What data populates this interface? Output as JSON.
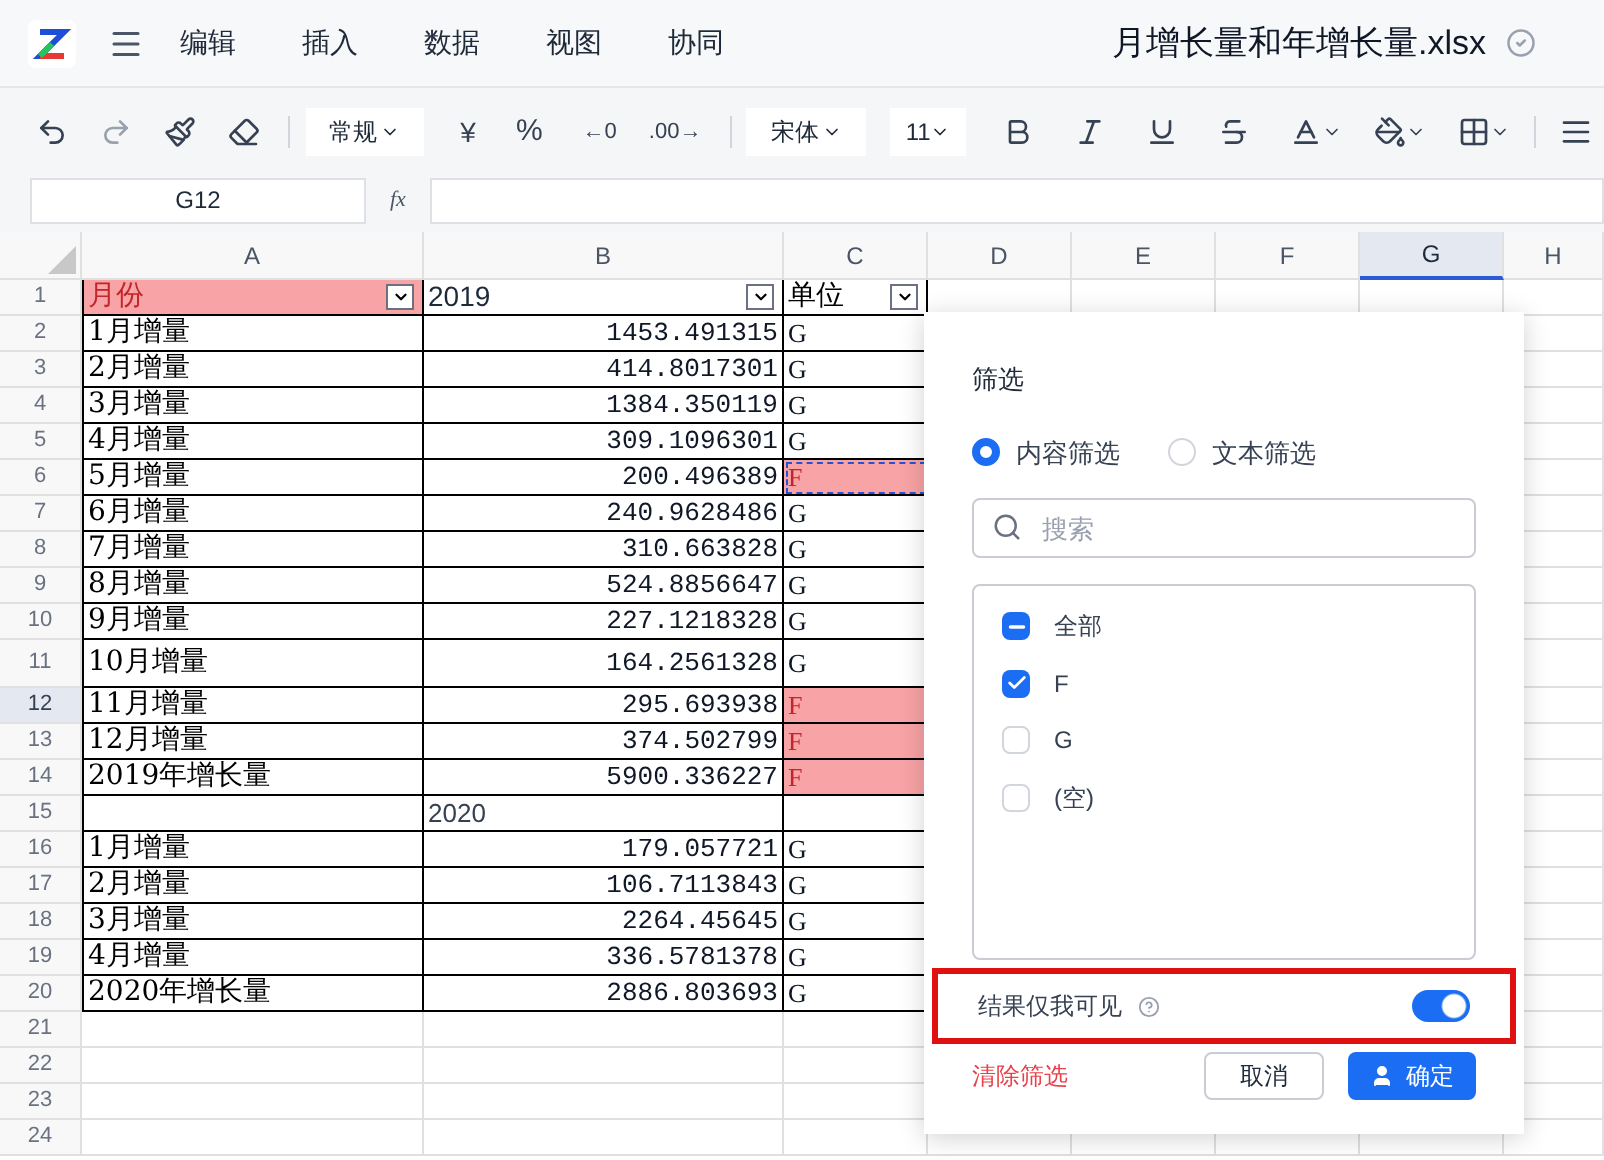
{
  "app": {
    "menu": [
      "编辑",
      "插入",
      "数据",
      "视图",
      "协同"
    ],
    "file_name": "月增长量和年增长量.xlsx"
  },
  "toolbar": {
    "number_format": "常规",
    "currency": "¥",
    "percent": "%",
    "decrease_decimal": "←0",
    "increase_decimal": ".00→",
    "font": "宋体",
    "font_size": "11"
  },
  "formula_bar": {
    "name_box": "G12",
    "fx": "fx"
  },
  "columns": [
    {
      "label": "A",
      "selected": false
    },
    {
      "label": "B",
      "selected": false
    },
    {
      "label": "C",
      "selected": false
    },
    {
      "label": "D",
      "selected": false
    },
    {
      "label": "E",
      "selected": false
    },
    {
      "label": "F",
      "selected": false
    },
    {
      "label": "G",
      "selected": true
    },
    {
      "label": "H",
      "selected": false
    }
  ],
  "rows": [
    {
      "n": "1",
      "kind": "header",
      "a": "月份",
      "b": "2019",
      "c": "单位",
      "selected": false
    },
    {
      "n": "2",
      "kind": "data",
      "a": "1月增量",
      "b": "1453.491315",
      "c": "G",
      "highlighted": false,
      "marquee": false,
      "selected": false
    },
    {
      "n": "3",
      "kind": "data",
      "a": "2月增量",
      "b": "414.8017301",
      "c": "G",
      "highlighted": false,
      "marquee": false,
      "selected": false
    },
    {
      "n": "4",
      "kind": "data",
      "a": "3月增量",
      "b": "1384.350119",
      "c": "G",
      "highlighted": false,
      "marquee": false,
      "selected": false
    },
    {
      "n": "5",
      "kind": "data",
      "a": "4月增量",
      "b": "309.1096301",
      "c": "G",
      "highlighted": false,
      "marquee": false,
      "selected": false
    },
    {
      "n": "6",
      "kind": "data",
      "a": "5月增量",
      "b": "200.496389",
      "c": "F",
      "highlighted": true,
      "marquee": true,
      "selected": false
    },
    {
      "n": "7",
      "kind": "data",
      "a": "6月增量",
      "b": "240.9628486",
      "c": "G",
      "highlighted": false,
      "marquee": false,
      "selected": false
    },
    {
      "n": "8",
      "kind": "data",
      "a": "7月增量",
      "b": "310.663828",
      "c": "G",
      "highlighted": false,
      "marquee": false,
      "selected": false
    },
    {
      "n": "9",
      "kind": "data",
      "a": "8月增量",
      "b": "524.8856647",
      "c": "G",
      "highlighted": false,
      "marquee": false,
      "selected": false
    },
    {
      "n": "10",
      "kind": "data",
      "a": "9月增量",
      "b": "227.1218328",
      "c": "G",
      "highlighted": false,
      "marquee": false,
      "selected": false
    },
    {
      "n": "11",
      "kind": "data",
      "tall": true,
      "a": "10月增量",
      "b": "164.2561328",
      "c": "G",
      "highlighted": false,
      "marquee": false,
      "selected": false
    },
    {
      "n": "12",
      "kind": "data",
      "a": "11月增量",
      "b": "295.693938",
      "c": "F",
      "highlighted": true,
      "marquee": false,
      "selected": true
    },
    {
      "n": "13",
      "kind": "data",
      "a": "12月增量",
      "b": "374.502799",
      "c": "F",
      "highlighted": true,
      "marquee": false,
      "selected": false
    },
    {
      "n": "14",
      "kind": "data",
      "a": "2019年增长量",
      "b": "5900.336227",
      "c": "F",
      "highlighted": true,
      "marquee": false,
      "selected": false
    },
    {
      "n": "15",
      "kind": "year",
      "b": "2020",
      "selected": false
    },
    {
      "n": "16",
      "kind": "data",
      "a": "1月增量",
      "b": "179.057721",
      "c": "G",
      "highlighted": false,
      "marquee": false,
      "selected": false
    },
    {
      "n": "17",
      "kind": "data",
      "a": "2月增量",
      "b": "106.7113843",
      "c": "G",
      "highlighted": false,
      "marquee": false,
      "selected": false
    },
    {
      "n": "18",
      "kind": "data",
      "a": "3月增量",
      "b": "2264.45645",
      "c": "G",
      "highlighted": false,
      "marquee": false,
      "selected": false
    },
    {
      "n": "19",
      "kind": "data",
      "a": "4月增量",
      "b": "336.5781378",
      "c": "G",
      "highlighted": false,
      "marquee": false,
      "selected": false
    },
    {
      "n": "20",
      "kind": "data",
      "a": "2020年增长量",
      "b": "2886.803693",
      "c": "G",
      "highlighted": false,
      "marquee": false,
      "selected": false
    },
    {
      "n": "21",
      "kind": "empty",
      "selected": false
    },
    {
      "n": "22",
      "kind": "empty",
      "selected": false
    },
    {
      "n": "23",
      "kind": "empty",
      "selected": false
    },
    {
      "n": "24",
      "kind": "empty",
      "selected": false
    }
  ],
  "filter": {
    "title": "筛选",
    "modes": [
      {
        "label": "内容筛选",
        "selected": true
      },
      {
        "label": "文本筛选",
        "selected": false
      }
    ],
    "search": {
      "placeholder": "搜索"
    },
    "options": [
      {
        "label": "全部",
        "checked": true,
        "indeterminate": true
      },
      {
        "label": "F",
        "checked": true
      },
      {
        "label": "G",
        "checked": false
      },
      {
        "label": "(空)",
        "checked": false
      }
    ],
    "visible_to_me_only": {
      "label": "结果仅我可见",
      "on": true,
      "highlighted": true
    },
    "clear": "清除筛选",
    "cancel": "取消",
    "confirm": "确定"
  }
}
